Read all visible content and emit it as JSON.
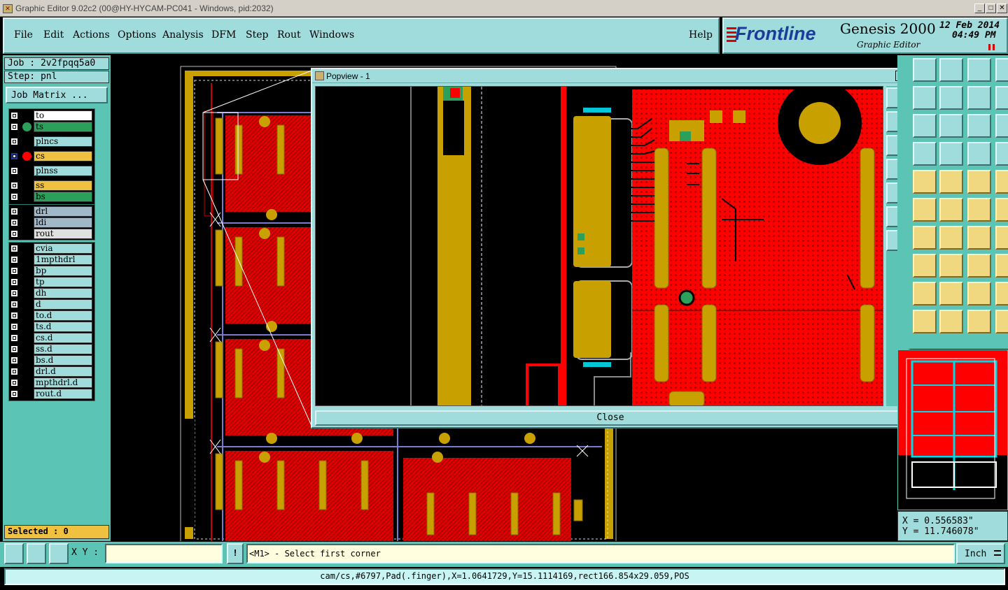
{
  "window": {
    "title": "Graphic Editor 9.02c2 (00@HY-HYCAM-PC041 - Windows, pid:2032)"
  },
  "menu": [
    "File",
    "Edit",
    "Actions",
    "Options",
    "Analysis",
    "DFM",
    "Step",
    "Rout",
    "Windows"
  ],
  "help_label": "Help",
  "logo": {
    "brand": "Frontline",
    "product": "Genesis 2000",
    "subtitle": "Graphic Editor",
    "date": "12 Feb 2014",
    "time": "04:49 PM"
  },
  "job": {
    "job_label": "Job : 2v2fpqq5a0",
    "step_label": "Step: pnl",
    "matrix_button": "Job Matrix ..."
  },
  "layers": [
    {
      "name": "to",
      "bg": "#ffffff",
      "dot": ""
    },
    {
      "name": "ts",
      "bg": "#2ca05a",
      "dot": "#2ca05a"
    },
    {
      "name": "plncs",
      "bg": "#a0dcdc",
      "dot": ""
    },
    {
      "name": "cs",
      "bg": "#f0c040",
      "dot": "#ff0000",
      "active": true
    },
    {
      "name": "plnss",
      "bg": "#a0dcdc",
      "dot": ""
    },
    {
      "name": "ss",
      "bg": "#f0c040",
      "dot": ""
    },
    {
      "name": "bs",
      "bg": "#2ca05a",
      "dot": ""
    },
    {
      "name": "drl",
      "bg": "#a0b8c8",
      "dot": ""
    },
    {
      "name": "ldi",
      "bg": "#a0b8c8",
      "dot": ""
    },
    {
      "name": "rout",
      "bg": "#e0e0e0",
      "dot": ""
    },
    {
      "name": "cvia",
      "bg": "#a0dcdc",
      "dot": ""
    },
    {
      "name": "1mpthdrl",
      "bg": "#a0dcdc",
      "dot": ""
    },
    {
      "name": "bp",
      "bg": "#a0dcdc",
      "dot": ""
    },
    {
      "name": "tp",
      "bg": "#a0dcdc",
      "dot": ""
    },
    {
      "name": "dh",
      "bg": "#a0dcdc",
      "dot": ""
    },
    {
      "name": "d",
      "bg": "#a0dcdc",
      "dot": ""
    },
    {
      "name": "to.d",
      "bg": "#a0dcdc",
      "dot": ""
    },
    {
      "name": "ts.d",
      "bg": "#a0dcdc",
      "dot": ""
    },
    {
      "name": "cs.d",
      "bg": "#a0dcdc",
      "dot": ""
    },
    {
      "name": "ss.d",
      "bg": "#a0dcdc",
      "dot": ""
    },
    {
      "name": "bs.d",
      "bg": "#a0dcdc",
      "dot": ""
    },
    {
      "name": "drl.d",
      "bg": "#a0dcdc",
      "dot": ""
    },
    {
      "name": "mpthdrl.d",
      "bg": "#a0dcdc",
      "dot": ""
    },
    {
      "name": "rout.d",
      "bg": "#a0dcdc",
      "dot": ""
    }
  ],
  "selected_label": "Selected : 0",
  "popview": {
    "title": "Popview - 1",
    "close_label": "Close"
  },
  "coords": {
    "x": "X = 0.556583\"",
    "y": "Y = 11.746078\""
  },
  "bottom": {
    "xy_label": "X Y :",
    "xy_value": "",
    "prompt": "<M1> - Select first corner",
    "units": "Inch"
  },
  "status": "cam/cs,#6797,Pad(.finger),X=1.0641729,Y=15.1114169,rect166.854x29.059,POS",
  "colors": {
    "panel": "#5cc4b4",
    "menu": "#a0dcdc",
    "copper": "#ff0000",
    "gold": "#c8a000",
    "selected_bg": "#f0c040"
  }
}
